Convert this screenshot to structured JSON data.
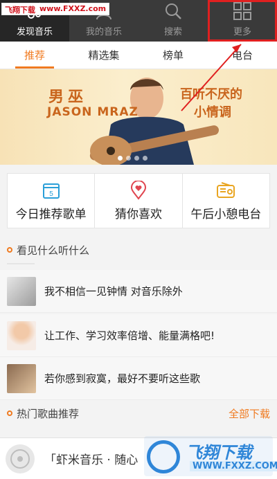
{
  "watermark_top": {
    "brand": "飞翔下载",
    "url": "www.FXXZ.com"
  },
  "nav": {
    "items": [
      {
        "label": "发现音乐",
        "icon": "music-note-icon",
        "active": true
      },
      {
        "label": "我的音乐",
        "icon": "user-icon",
        "active": false
      },
      {
        "label": "搜索",
        "icon": "search-icon",
        "active": false
      },
      {
        "label": "更多",
        "icon": "grid-icon",
        "active": false,
        "highlighted": true
      }
    ]
  },
  "tabs": [
    {
      "label": "推荐",
      "active": true
    },
    {
      "label": "精选集",
      "active": false
    },
    {
      "label": "榜单",
      "active": false
    },
    {
      "label": "电台",
      "active": false
    }
  ],
  "banner": {
    "artist_cn": "男巫",
    "artist_en": "JASON MRAZ",
    "slogan_line1": "百听不厌的",
    "slogan_line2": "小情调",
    "dots_total": 4,
    "dots_active": 1
  },
  "quick": [
    {
      "label": "今日推荐歌单",
      "icon": "calendar-icon"
    },
    {
      "label": "猜你喜欢",
      "icon": "heart-location-icon"
    },
    {
      "label": "午后小憩电台",
      "icon": "radio-icon"
    }
  ],
  "section1": {
    "title": "看见什么听什么"
  },
  "rows": [
    {
      "text": "我不相信一见钟情 对音乐除外"
    },
    {
      "text": "让工作、学习效率倍增、能量满格吧!"
    },
    {
      "text": "若你感到寂寞，最好不要听这些歌"
    }
  ],
  "section2": {
    "title": "热门歌曲推荐",
    "action": "全部下载"
  },
  "player": {
    "text": "「虾米音乐 · 随心"
  },
  "watermark_bottom": {
    "brand": "飞翔下载",
    "url": "WWW.FXXZ.COM"
  },
  "colors": {
    "accent": "#f07a1f",
    "nav_bg": "#3a3a3a",
    "highlight": "#e02020"
  }
}
